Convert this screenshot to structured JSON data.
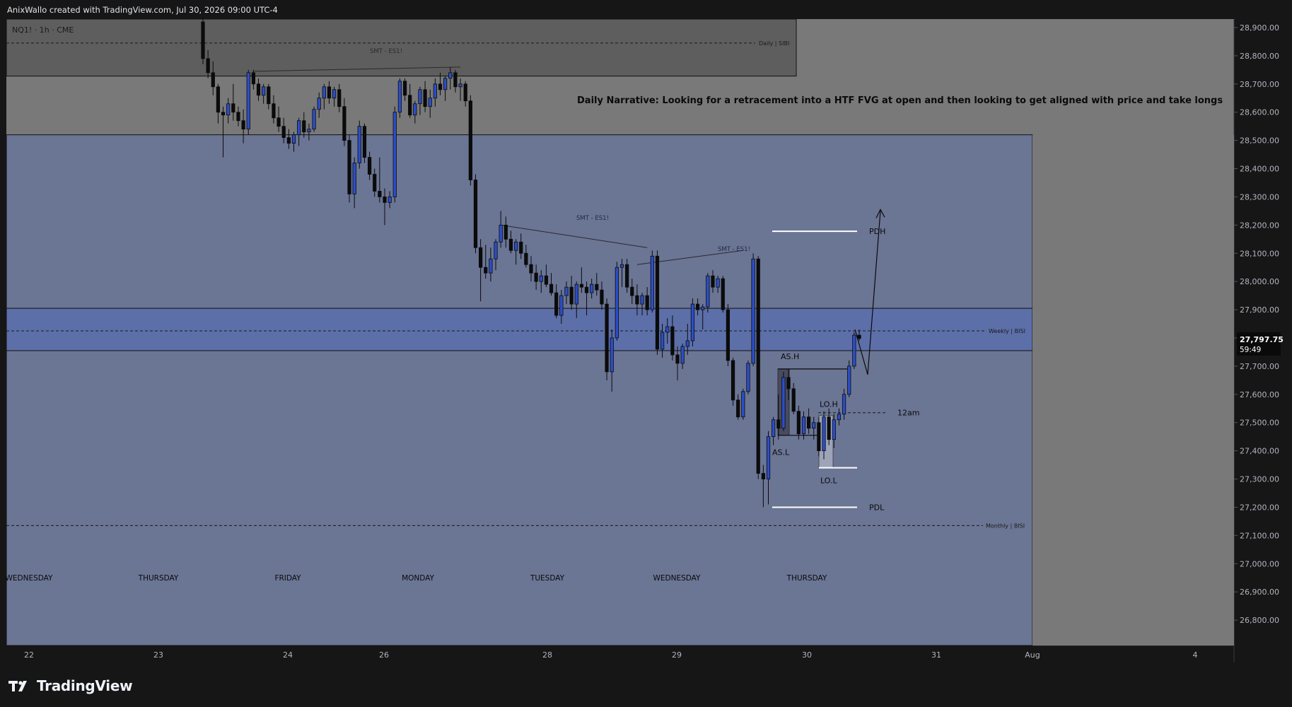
{
  "header": {
    "credit": "AnixWallo created with TradingView.com, Jul 30, 2026 09:00 UTC-4"
  },
  "symbol_label": "NQ1! · 1h · CME",
  "narrative": "Daily Narrative: Looking for a retracement into a HTF FVG at open and then looking to get aligned with price and take longs",
  "price_badge": {
    "price": "27,797.75",
    "countdown": "59:49"
  },
  "footer": {
    "brand": "TradingView"
  },
  "colors": {
    "background": "#797979",
    "zone_blue": "#6b7594",
    "band_blue": "#5d6fa8",
    "candle_up": "#2c4ec5",
    "candle_down": "#0b0b0b",
    "outer_bg": "#161616"
  },
  "chart_data": {
    "type": "candlestick",
    "symbol": "NQ1!",
    "timeframe": "1h",
    "exchange": "CME",
    "ylim": [
      26710,
      28930
    ],
    "y_ticks": [
      "28,900.00",
      "28,800.00",
      "28,700.00",
      "28,600.00",
      "28,500.00",
      "28,400.00",
      "28,300.00",
      "28,200.00",
      "28,100.00",
      "28,000.00",
      "27,900.00",
      "27,800.00",
      "27,700.00",
      "27,600.00",
      "27,500.00",
      "27,400.00",
      "27,300.00",
      "27,200.00",
      "27,100.00",
      "27,000.00",
      "26,900.00",
      "26,800.00"
    ],
    "x_ticks": [
      "22",
      "23",
      "24",
      "26",
      "28",
      "29",
      "30",
      "31",
      "Aug",
      "4"
    ],
    "day_labels": [
      "WEDNESDAY",
      "THURSDAY",
      "FRIDAY",
      "MONDAY",
      "TUESDAY",
      "WEDNESDAY",
      "THURSDAY"
    ],
    "last_price": 27797.75,
    "zones": [
      {
        "label": "Daily | SIBI",
        "low": 28728,
        "high": 28930,
        "midline": 28845
      },
      {
        "label": "",
        "low": 26710,
        "high": 28520
      },
      {
        "label": "Weekly | BISI",
        "low": 27755,
        "high": 27905,
        "midline": 27825
      },
      {
        "label": "Monthly | BISI",
        "level": 27135
      }
    ],
    "levels": [
      {
        "label": "PDH",
        "value": 28178
      },
      {
        "label": "PDL",
        "value": 27200
      },
      {
        "label": "12am",
        "value": 27535
      },
      {
        "label": "AS.H",
        "value": 27690
      },
      {
        "label": "AS.L",
        "value": 27455
      },
      {
        "label": "LO.H",
        "value": 27525
      },
      {
        "label": "LO.L",
        "value": 27340
      }
    ],
    "annotations": [
      "SMT - ES1!",
      "SMT - ES1!",
      "SMT - ES1!"
    ],
    "candles": [
      [
        28920,
        28935,
        28770,
        28790
      ],
      [
        28790,
        28820,
        28720,
        28740
      ],
      [
        28740,
        28780,
        28660,
        28690
      ],
      [
        28690,
        28700,
        28560,
        28600
      ],
      [
        28600,
        28620,
        28440,
        28590
      ],
      [
        28590,
        28650,
        28560,
        28630
      ],
      [
        28630,
        28700,
        28570,
        28600
      ],
      [
        28600,
        28620,
        28550,
        28570
      ],
      [
        28570,
        28610,
        28490,
        28540
      ],
      [
        28540,
        28750,
        28520,
        28740
      ],
      [
        28740,
        28750,
        28680,
        28700
      ],
      [
        28700,
        28720,
        28640,
        28660
      ],
      [
        28660,
        28700,
        28630,
        28690
      ],
      [
        28690,
        28700,
        28610,
        28630
      ],
      [
        28630,
        28660,
        28560,
        28580
      ],
      [
        28580,
        28620,
        28530,
        28550
      ],
      [
        28550,
        28580,
        28490,
        28510
      ],
      [
        28510,
        28540,
        28470,
        28490
      ],
      [
        28490,
        28530,
        28460,
        28520
      ],
      [
        28520,
        28580,
        28480,
        28570
      ],
      [
        28570,
        28600,
        28510,
        28530
      ],
      [
        28530,
        28560,
        28500,
        28540
      ],
      [
        28540,
        28620,
        28530,
        28610
      ],
      [
        28610,
        28670,
        28580,
        28650
      ],
      [
        28650,
        28700,
        28610,
        28690
      ],
      [
        28690,
        28710,
        28630,
        28650
      ],
      [
        28650,
        28690,
        28620,
        28680
      ],
      [
        28680,
        28700,
        28600,
        28620
      ],
      [
        28620,
        28650,
        28480,
        28500
      ],
      [
        28500,
        28520,
        28280,
        28310
      ],
      [
        28310,
        28440,
        28260,
        28420
      ],
      [
        28420,
        28570,
        28400,
        28550
      ],
      [
        28550,
        28560,
        28420,
        28440
      ],
      [
        28440,
        28460,
        28360,
        28380
      ],
      [
        28380,
        28400,
        28300,
        28320
      ],
      [
        28320,
        28440,
        28280,
        28300
      ],
      [
        28300,
        28330,
        28200,
        28280
      ],
      [
        28280,
        28320,
        28260,
        28300
      ],
      [
        28300,
        28620,
        28280,
        28600
      ],
      [
        28600,
        28720,
        28580,
        28710
      ],
      [
        28710,
        28720,
        28640,
        28660
      ],
      [
        28660,
        28700,
        28580,
        28590
      ],
      [
        28590,
        28640,
        28560,
        28630
      ],
      [
        28630,
        28690,
        28590,
        28680
      ],
      [
        28680,
        28710,
        28600,
        28620
      ],
      [
        28620,
        28680,
        28580,
        28650
      ],
      [
        28650,
        28720,
        28620,
        28700
      ],
      [
        28700,
        28740,
        28660,
        28680
      ],
      [
        28680,
        28730,
        28640,
        28720
      ],
      [
        28720,
        28760,
        28680,
        28740
      ],
      [
        28740,
        28750,
        28670,
        28690
      ],
      [
        28690,
        28720,
        28640,
        28700
      ],
      [
        28700,
        28710,
        28620,
        28640
      ],
      [
        28640,
        28660,
        28340,
        28360
      ],
      [
        28360,
        28380,
        28100,
        28120
      ],
      [
        28120,
        28150,
        27930,
        28050
      ],
      [
        28050,
        28130,
        28010,
        28030
      ],
      [
        28030,
        28120,
        28000,
        28080
      ],
      [
        28080,
        28150,
        28040,
        28140
      ],
      [
        28140,
        28250,
        28120,
        28200
      ],
      [
        28200,
        28230,
        28120,
        28150
      ],
      [
        28150,
        28180,
        28100,
        28110
      ],
      [
        28110,
        28150,
        28060,
        28140
      ],
      [
        28140,
        28170,
        28080,
        28100
      ],
      [
        28100,
        28130,
        28050,
        28060
      ],
      [
        28060,
        28090,
        28000,
        28030
      ],
      [
        28030,
        28060,
        27970,
        28000
      ],
      [
        28000,
        28040,
        27960,
        28020
      ],
      [
        28020,
        28060,
        27980,
        27990
      ],
      [
        27990,
        28030,
        27950,
        27960
      ],
      [
        27960,
        27990,
        27870,
        27880
      ],
      [
        27880,
        27970,
        27850,
        27950
      ],
      [
        27950,
        28000,
        27920,
        27980
      ],
      [
        27980,
        28020,
        27900,
        27920
      ],
      [
        27920,
        28000,
        27870,
        27990
      ],
      [
        27990,
        28050,
        27960,
        27980
      ],
      [
        27980,
        28000,
        27880,
        27960
      ],
      [
        27960,
        28010,
        27940,
        27990
      ],
      [
        27990,
        28030,
        27950,
        27970
      ],
      [
        27970,
        28000,
        27900,
        27920
      ],
      [
        27920,
        27940,
        27650,
        27680
      ],
      [
        27680,
        27830,
        27610,
        27800
      ],
      [
        27800,
        28070,
        27790,
        28050
      ],
      [
        28050,
        28080,
        27980,
        28060
      ],
      [
        28060,
        28080,
        27960,
        27980
      ],
      [
        27980,
        28010,
        27920,
        27950
      ],
      [
        27950,
        27990,
        27880,
        27920
      ],
      [
        27920,
        27960,
        27880,
        27950
      ],
      [
        27950,
        27980,
        27880,
        27900
      ],
      [
        27900,
        28110,
        27890,
        28090
      ],
      [
        28090,
        28110,
        27740,
        27760
      ],
      [
        27760,
        27850,
        27730,
        27820
      ],
      [
        27820,
        27870,
        27780,
        27840
      ],
      [
        27840,
        27880,
        27720,
        27740
      ],
      [
        27740,
        27770,
        27650,
        27710
      ],
      [
        27710,
        27780,
        27690,
        27770
      ],
      [
        27770,
        27850,
        27740,
        27790
      ],
      [
        27790,
        27940,
        27770,
        27920
      ],
      [
        27920,
        27940,
        27880,
        27900
      ],
      [
        27900,
        27920,
        27830,
        27910
      ],
      [
        27910,
        28030,
        27890,
        28020
      ],
      [
        28020,
        28040,
        27960,
        27980
      ],
      [
        27980,
        28020,
        27960,
        28010
      ],
      [
        28010,
        28020,
        27890,
        27900
      ],
      [
        27900,
        27920,
        27700,
        27720
      ],
      [
        27720,
        27730,
        27560,
        27580
      ],
      [
        27580,
        27600,
        27510,
        27520
      ],
      [
        27520,
        27620,
        27510,
        27610
      ],
      [
        27610,
        27720,
        27600,
        27710
      ],
      [
        27710,
        28100,
        27700,
        28080
      ],
      [
        28080,
        28090,
        27300,
        27320
      ],
      [
        27320,
        27350,
        27200,
        27300
      ],
      [
        27300,
        27470,
        27210,
        27450
      ],
      [
        27450,
        27520,
        27420,
        27510
      ],
      [
        27510,
        27600,
        27440,
        27480
      ],
      [
        27480,
        27680,
        27470,
        27660
      ],
      [
        27660,
        27690,
        27580,
        27620
      ],
      [
        27620,
        27640,
        27530,
        27540
      ],
      [
        27540,
        27560,
        27440,
        27460
      ],
      [
        27460,
        27540,
        27440,
        27520
      ],
      [
        27520,
        27550,
        27460,
        27480
      ],
      [
        27480,
        27520,
        27440,
        27500
      ],
      [
        27500,
        27520,
        27380,
        27400
      ],
      [
        27400,
        27540,
        27370,
        27520
      ],
      [
        27520,
        27550,
        27420,
        27440
      ],
      [
        27440,
        27530,
        27410,
        27510
      ],
      [
        27510,
        27550,
        27490,
        27530
      ],
      [
        27530,
        27620,
        27510,
        27600
      ],
      [
        27600,
        27720,
        27590,
        27700
      ],
      [
        27700,
        27820,
        27690,
        27810
      ],
      [
        27810,
        27830,
        27790,
        27798
      ]
    ]
  }
}
